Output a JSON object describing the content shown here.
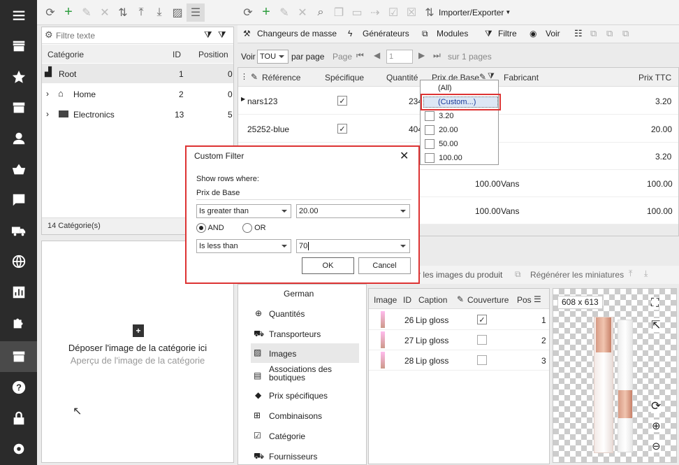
{
  "left_toolbar": {
    "icons": [
      "refresh-icon",
      "add-icon",
      "edit-icon",
      "delete-icon",
      "move-icon",
      "expand-icon",
      "collapse-icon",
      "image-icon",
      "filter-rows-icon"
    ]
  },
  "category_tree": {
    "search_placeholder": "Filtre texte",
    "columns": [
      "Catégorie",
      "ID",
      "Position"
    ],
    "rows": [
      {
        "name": "Root",
        "id": "1",
        "position": "0"
      },
      {
        "name": "Home",
        "id": "2",
        "position": "0"
      },
      {
        "name": "Electronics",
        "id": "13",
        "position": "5"
      }
    ],
    "footer": "14 Catégorie(s)"
  },
  "dropzone": {
    "title": "Déposer l'image de la catégorie ici",
    "subtitle": "Aperçu de l'image de la catégorie"
  },
  "main_toolbar": {
    "import_export": "Importer/Exporter"
  },
  "second_toolbar": {
    "mass": "Changeurs de masse",
    "generators": "Générateurs",
    "modules": "Modules",
    "filter": "Filtre",
    "view": "Voir"
  },
  "paging": {
    "show": "Voir",
    "per_page_value": "TOU",
    "per_page": "par page",
    "page": "Page",
    "page_value": "1",
    "of_pages": "sur 1 pages"
  },
  "grid": {
    "columns": {
      "reference": "Référence",
      "specific": "Spécifique",
      "quantity": "Quantité",
      "base_price": "Prix de Base",
      "manufacturer": "Fabricant",
      "price_ttc": "Prix TTC"
    },
    "rows": [
      {
        "reference": "nars123",
        "specific": true,
        "quantity": "234",
        "base_price": "",
        "manufacturer": "",
        "price_ttc": "3.20"
      },
      {
        "reference": "25252-blue",
        "specific": true,
        "quantity": "404",
        "base_price": "",
        "manufacturer": "",
        "price_ttc": "20.00"
      },
      {
        "reference": "",
        "specific": false,
        "quantity": "",
        "base_price": "",
        "manufacturer": "",
        "price_ttc": "3.20"
      },
      {
        "reference": "",
        "specific": false,
        "quantity": "",
        "base_price": "100.00",
        "manufacturer": "Vans",
        "price_ttc": "100.00"
      },
      {
        "reference": "",
        "specific": false,
        "quantity": "",
        "base_price": "100.00",
        "manufacturer": "Vans",
        "price_ttc": "100.00"
      }
    ]
  },
  "filter_dropdown": {
    "items": [
      "(All)",
      "(Custom...)",
      "3.20",
      "20.00",
      "50.00",
      "100.00"
    ]
  },
  "dialog": {
    "title": "Custom Filter",
    "show_rows": "Show rows where:",
    "field": "Prix de Base",
    "op1": "Is greater than",
    "val1": "20.00",
    "and": "AND",
    "or": "OR",
    "op2": "Is less than",
    "val2": "70",
    "ok": "OK",
    "cancel": "Cancel"
  },
  "detail_tabs": {
    "language": "German",
    "items": [
      "Quantités",
      "Transporteurs",
      "Images",
      "Associations des boutiques",
      "Prix spécifiques",
      "Combinaisons",
      "Catégorie",
      "Fournisseurs"
    ]
  },
  "images_toolbar": {
    "upload": "r les images du produit",
    "regen": "Régénérer les miniatures"
  },
  "images_grid": {
    "columns": [
      "Image",
      "ID",
      "Caption",
      "Couverture",
      "Pos"
    ],
    "rows": [
      {
        "id": "26",
        "caption": "Lip gloss",
        "cover": true,
        "pos": "1"
      },
      {
        "id": "27",
        "caption": "Lip gloss",
        "cover": false,
        "pos": "2"
      },
      {
        "id": "28",
        "caption": "Lip gloss",
        "cover": false,
        "pos": "3"
      }
    ]
  },
  "preview": {
    "size": "608 x 613"
  }
}
